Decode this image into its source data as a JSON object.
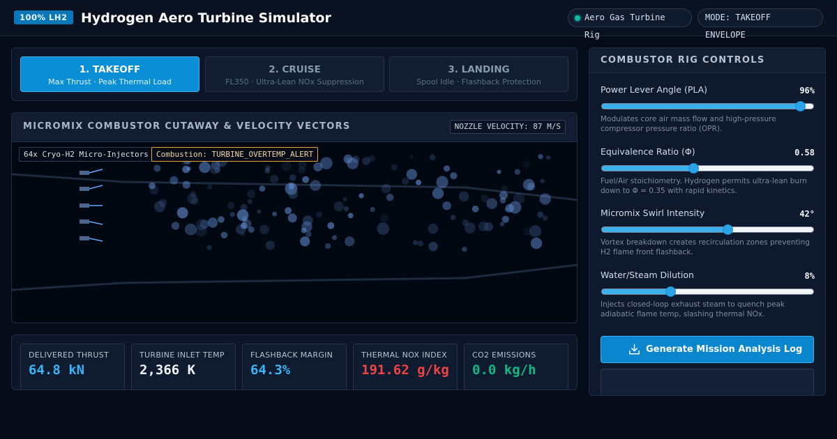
{
  "header": {
    "fuel_badge": "100% LH2",
    "title": "Hydrogen Aero Turbine Simulator",
    "rig_label": "Aero Gas Turbine Rig",
    "mode_label": "MODE: TAKEOFF ENVELOPE",
    "rig_status_color": "#14b8a6"
  },
  "phases": [
    {
      "title": "1. TAKEOFF",
      "subtitle": "Max Thrust · Peak Thermal Load",
      "active": true
    },
    {
      "title": "2. CRUISE",
      "subtitle": "FL350 · Ultra-Lean NOx Suppression",
      "active": false
    },
    {
      "title": "3. LANDING",
      "subtitle": "Spool Idle · Flashback Protection",
      "active": false
    }
  ],
  "cutaway": {
    "title": "MICROMIX COMBUSTOR CUTAWAY & VELOCITY VECTORS",
    "velocity_badge": "NOZZLE VELOCITY: 87 M/S",
    "injector_tag": "64x Cryo-H2 Micro-Injectors",
    "combustion_tag": "Combustion: TURBINE_OVERTEMP_ALERT",
    "alert_color": "#e7a53a"
  },
  "metrics": [
    {
      "label": "DELIVERED THRUST",
      "value": "64.8 kN",
      "color": "#3ab6f5"
    },
    {
      "label": "TURBINE INLET TEMP",
      "value": "2,366 K",
      "color": "#f1f5f9"
    },
    {
      "label": "FLASHBACK MARGIN",
      "value": "64.3%",
      "color": "#3ab6f5"
    },
    {
      "label": "THERMAL NOX INDEX",
      "value": "191.62 g/kg",
      "color": "#ef4444"
    },
    {
      "label": "CO2 EMISSIONS",
      "value": "0.0 kg/h",
      "color": "#10b981"
    }
  ],
  "controls": {
    "title": "COMBUSTOR RIG CONTROLS",
    "items": [
      {
        "label": "Power Lever Angle (PLA)",
        "value": "96%",
        "level": 0.93,
        "description": "Modulates core air mass flow and high-pressure compressor pressure ratio (OPR)."
      },
      {
        "label": "Equivalence Ratio (Φ)",
        "value": "0.58",
        "level": 0.43,
        "description": "Fuel/Air stoichiometry. Hydrogen permits ultra-lean burn down to Φ = 0.35 with rapid kinetics."
      },
      {
        "label": "Micromix Swirl Intensity",
        "value": "42°",
        "level": 0.59,
        "description": "Vortex breakdown creates recirculation zones preventing H2 flame front flashback."
      },
      {
        "label": "Water/Steam Dilution",
        "value": "8%",
        "level": 0.32,
        "description": "Injects closed-loop exhaust steam to quench peak adiabatic flame temp, slashing thermal NOx."
      }
    ],
    "generate_button": "Generate Mission Analysis Log"
  }
}
